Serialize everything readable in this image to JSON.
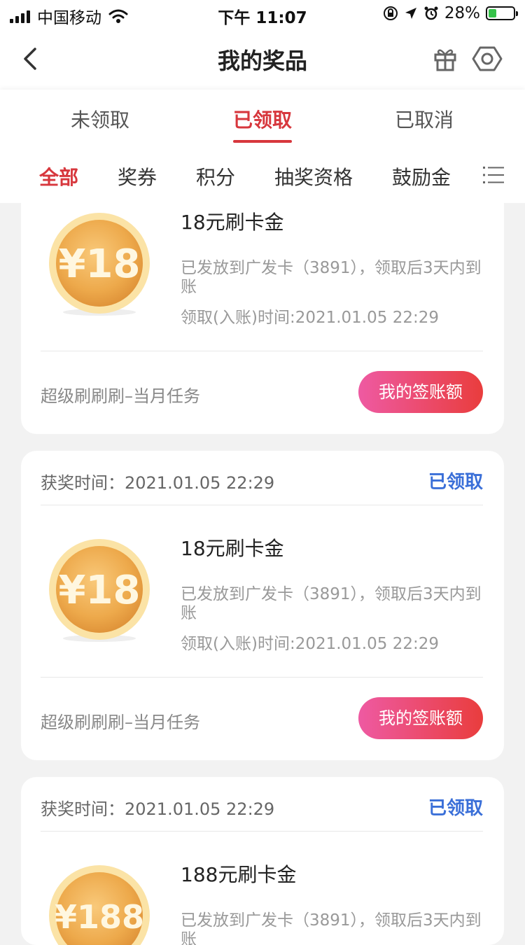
{
  "status_bar": {
    "carrier": "中国移动",
    "time": "下午 11:07",
    "battery": "28%"
  },
  "navbar": {
    "title": "我的奖品"
  },
  "main_tabs": [
    "未领取",
    "已领取",
    "已取消"
  ],
  "category_tabs": [
    "全部",
    "奖券",
    "积分",
    "抽奖资格",
    "鼓励金"
  ],
  "cards": [
    {
      "prize_name": "18元刷卡金",
      "coin_label": "¥18",
      "description": "已发放到广发卡（3891），领取后3天内到账",
      "claim_time": "领取(入账)时间:2021.01.05 22:29",
      "source": "超级刷刷刷–当月任务",
      "button": "我的签账额"
    },
    {
      "award_time": "获奖时间：2021.01.05 22:29",
      "status": "已领取",
      "prize_name": "18元刷卡金",
      "coin_label": "¥18",
      "description": "已发放到广发卡（3891），领取后3天内到账",
      "claim_time": "领取(入账)时间:2021.01.05 22:29",
      "source": "超级刷刷刷–当月任务",
      "button": "我的签账额"
    },
    {
      "award_time": "获奖时间：2021.01.05 22:29",
      "status": "已领取",
      "prize_name": "188元刷卡金",
      "coin_label": "¥188",
      "description": "已发放到广发卡（3891），领取后3天内到账"
    }
  ],
  "colors": {
    "accent_red": "#d7373d",
    "status_blue": "#3a6fd8",
    "button_gradient_start": "#ee5aa2",
    "button_gradient_end": "#e93d3d"
  }
}
